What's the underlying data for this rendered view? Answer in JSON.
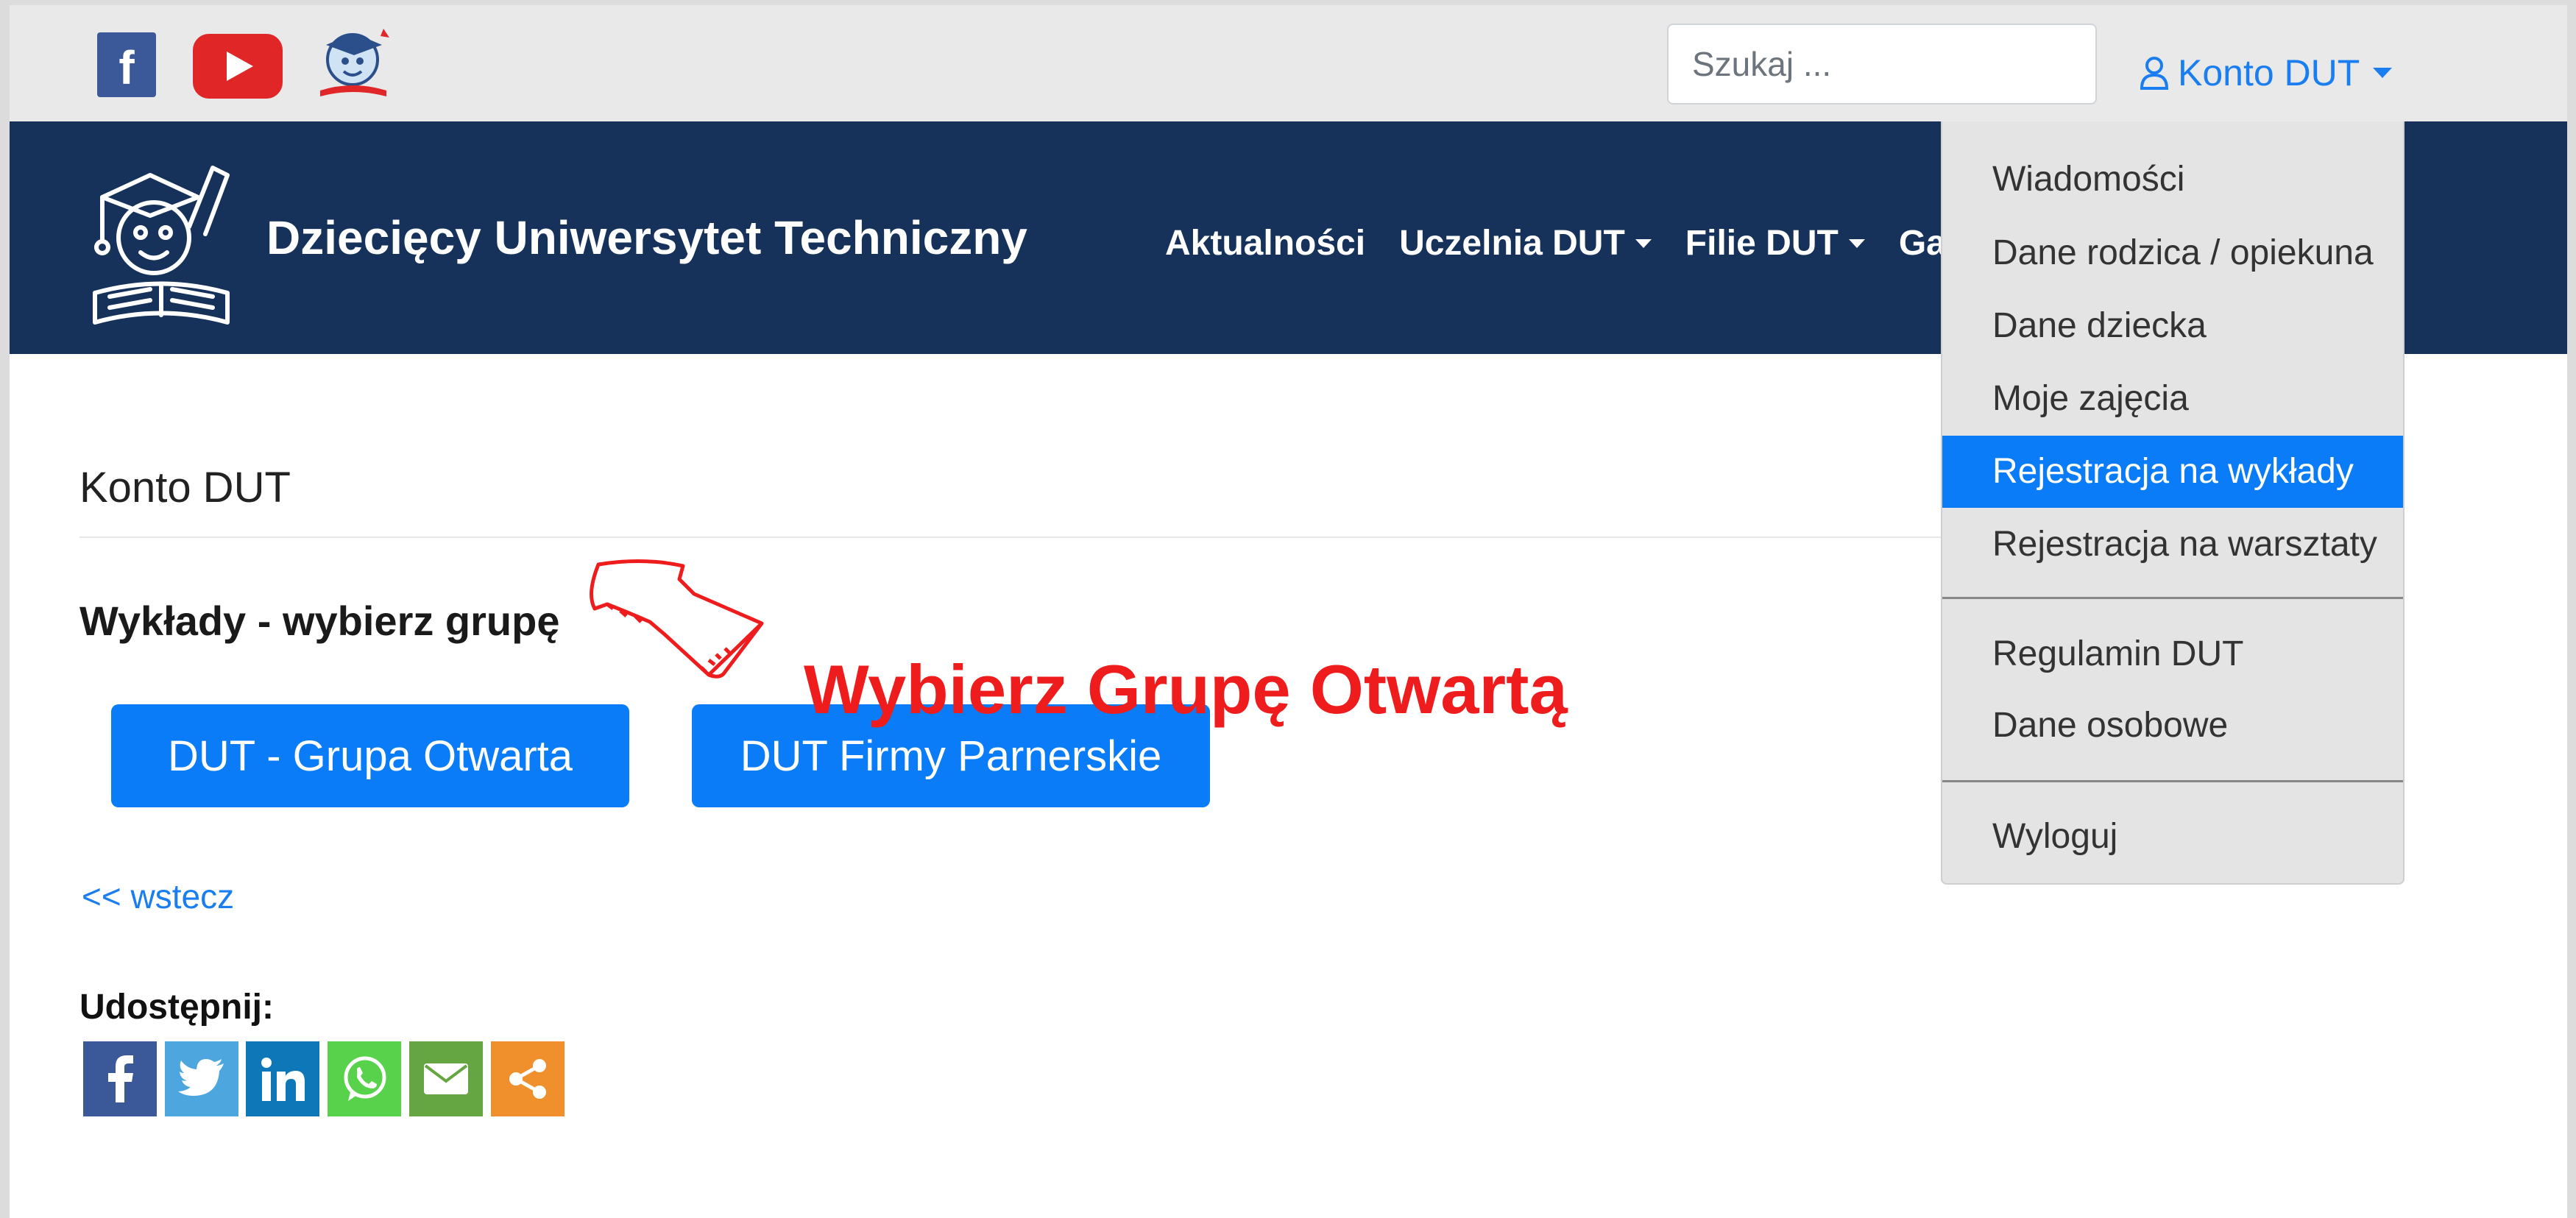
{
  "topbar": {
    "search_placeholder": "Szukaj ...",
    "account_label": "Konto DUT"
  },
  "navbar": {
    "site_title": "Dziecięcy Uniwersytet Techniczny",
    "links": [
      "Aktualności",
      "Uczelnia DUT",
      "Filie DUT",
      "Galeria"
    ]
  },
  "dropdown": {
    "items": [
      "Wiadomości",
      "Dane rodzica / opiekuna",
      "Dane dziecka",
      "Moje zajęcia",
      "Rejestracja na wykłady",
      "Rejestracja na warsztaty",
      "Regulamin DUT",
      "Dane osobowe",
      "Wyloguj"
    ],
    "active_item": "Rejestracja na wykłady"
  },
  "main": {
    "page_title": "Konto DUT",
    "section_title": "Wykłady - wybierz grupę",
    "buttons": [
      "DUT - Grupa Otwarta",
      "DUT Firmy Parnerskie"
    ],
    "back_link": "<< wstecz",
    "share_label": "Udostępnij:"
  },
  "annotation": {
    "text": "Wybierz Grupę Otwartą",
    "color": "#ee1c1c"
  },
  "colors": {
    "navbar_bg": "#16325b",
    "primary": "#0a7cf8",
    "link": "#1a7ef0",
    "topbar_bg": "#e9e9e9"
  },
  "share_icons": [
    "facebook-icon",
    "twitter-icon",
    "linkedin-icon",
    "whatsapp-icon",
    "email-icon",
    "share-icon"
  ]
}
